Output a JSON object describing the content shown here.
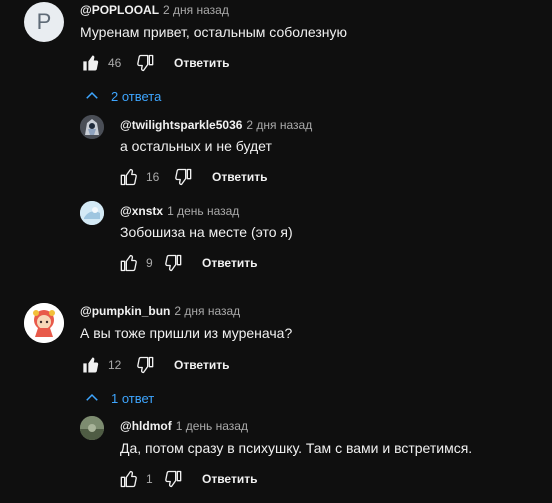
{
  "comments": [
    {
      "author": "@POPLOOAL",
      "time": "2 дня назад",
      "text": "Муренам привет, остальным соболезную",
      "likes": "46",
      "reply_label": "Ответить",
      "avatar_letter": "P",
      "replies_toggle": "2 ответа",
      "replies": [
        {
          "author": "@twilightsparkle5036",
          "time": "2 дня назад",
          "text": "а остальных и не будет",
          "likes": "16",
          "reply_label": "Ответить"
        },
        {
          "author": "@xnstx",
          "time": "1 день назад",
          "text": "Зобошиза на месте (это я)",
          "likes": "9",
          "reply_label": "Ответить"
        }
      ]
    },
    {
      "author": "@pumpkin_bun",
      "time": "2 дня назад",
      "text": "А вы тоже пришли из муренача?",
      "likes": "12",
      "reply_label": "Ответить",
      "replies_toggle": "1 ответ",
      "replies": [
        {
          "author": "@hldmof",
          "time": "1 день назад",
          "text": "Да, потом сразу в психушку. Там с вами и встретимся.",
          "likes": "1",
          "reply_label": "Ответить"
        }
      ]
    }
  ]
}
